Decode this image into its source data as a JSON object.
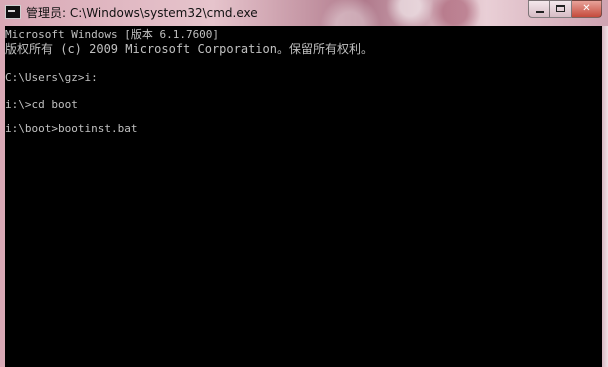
{
  "window": {
    "title": "管理员: C:\\Windows\\system32\\cmd.exe",
    "controls": {
      "minimize": "",
      "maximize": "",
      "close": "✕"
    }
  },
  "console": {
    "lines": [
      "Microsoft Windows [版本 6.1.7600]",
      "版权所有 (c) 2009 Microsoft Corporation。保留所有权利。",
      "C:\\Users\\gz>i:",
      "i:\\>cd boot",
      "i:\\boot>bootinst.bat"
    ]
  },
  "colors": {
    "console_bg": "#000000",
    "console_text": "#c0c0c0",
    "close_button": "#c54b3c"
  },
  "icons": {
    "app": "cmd-icon",
    "minimize": "minimize-icon",
    "maximize": "maximize-icon",
    "close": "close-icon"
  }
}
